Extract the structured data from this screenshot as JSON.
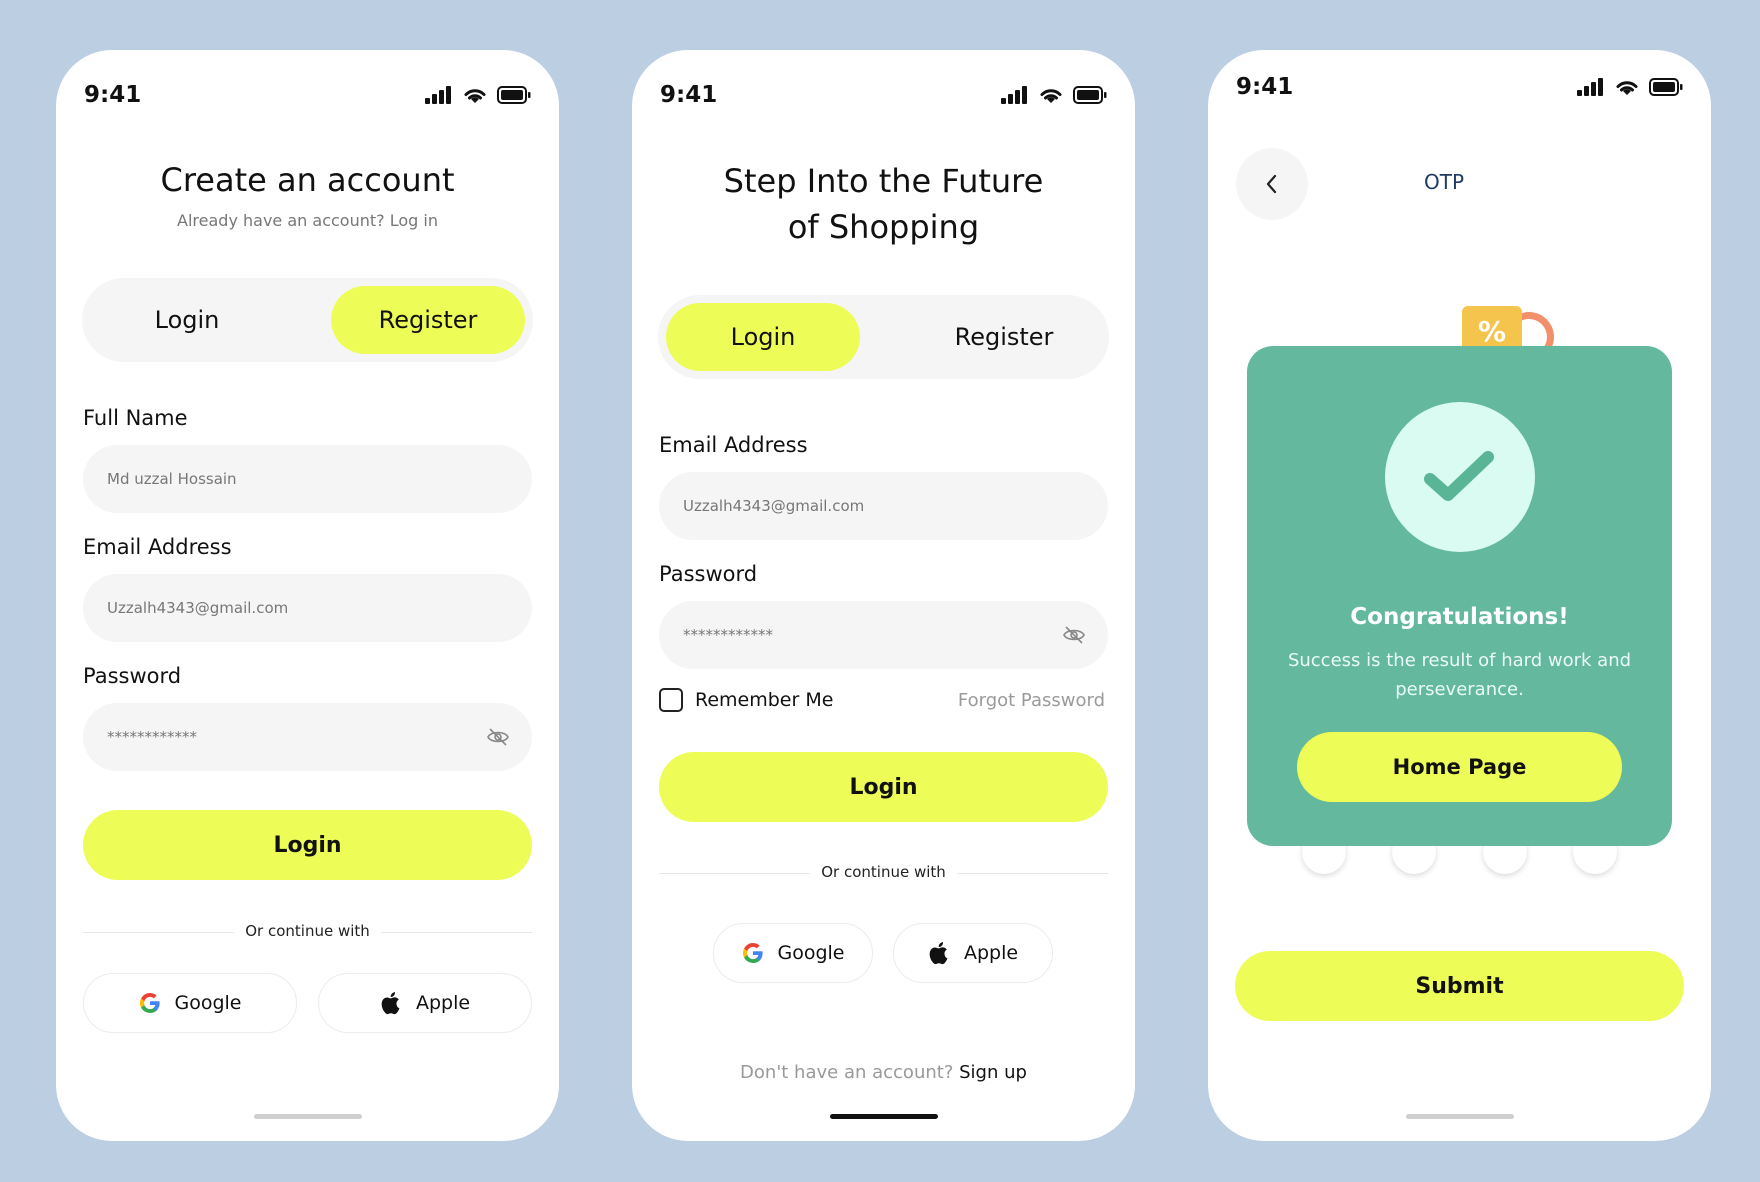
{
  "status_time": "9:41",
  "screen1": {
    "title": "Create an account",
    "subtitle": "Already have an account? Log in",
    "tabs": {
      "login": "Login",
      "register": "Register",
      "active": "Register"
    },
    "full_name": {
      "label": "Full Name",
      "value": "Md uzzal Hossain"
    },
    "email": {
      "label": "Email Address",
      "value": "Uzzalh4343@gmail.com"
    },
    "password": {
      "label": "Password",
      "value": "************"
    },
    "login_button": "Login",
    "divider_text": "Or continue with",
    "google": "Google",
    "apple": "Apple"
  },
  "screen2": {
    "title_line1": "Step Into the Future",
    "title_line2": "of Shopping",
    "tabs": {
      "login": "Login",
      "register": "Register",
      "active": "Login"
    },
    "email": {
      "label": "Email Address",
      "value": "Uzzalh4343@gmail.com"
    },
    "password": {
      "label": "Password",
      "value": "************"
    },
    "remember_me": "Remember Me",
    "forgot_password": "Forgot Password",
    "login_button": "Login",
    "divider_text": "Or continue with",
    "google": "Google",
    "apple": "Apple",
    "signup_prompt": "Don't have an account?",
    "signup_link": "Sign up"
  },
  "screen3": {
    "header_title": "OTP",
    "modal": {
      "title": "Congratulations!",
      "message": "Success is the result of hard work and perseverance.",
      "button": "Home Page"
    },
    "tag_symbol": "%",
    "submit_button": "Submit"
  },
  "colors": {
    "background": "#bccee2",
    "accent": "#eefc57",
    "modal": "#63b89e",
    "check_circle": "#dafbf2",
    "check_mark": "#5ab597"
  },
  "icons": [
    "signal-icon",
    "wifi-icon",
    "battery-icon",
    "eye-off-icon",
    "google-icon",
    "apple-icon",
    "chevron-left-icon",
    "checkmark-icon",
    "discount-tag-icon"
  ]
}
